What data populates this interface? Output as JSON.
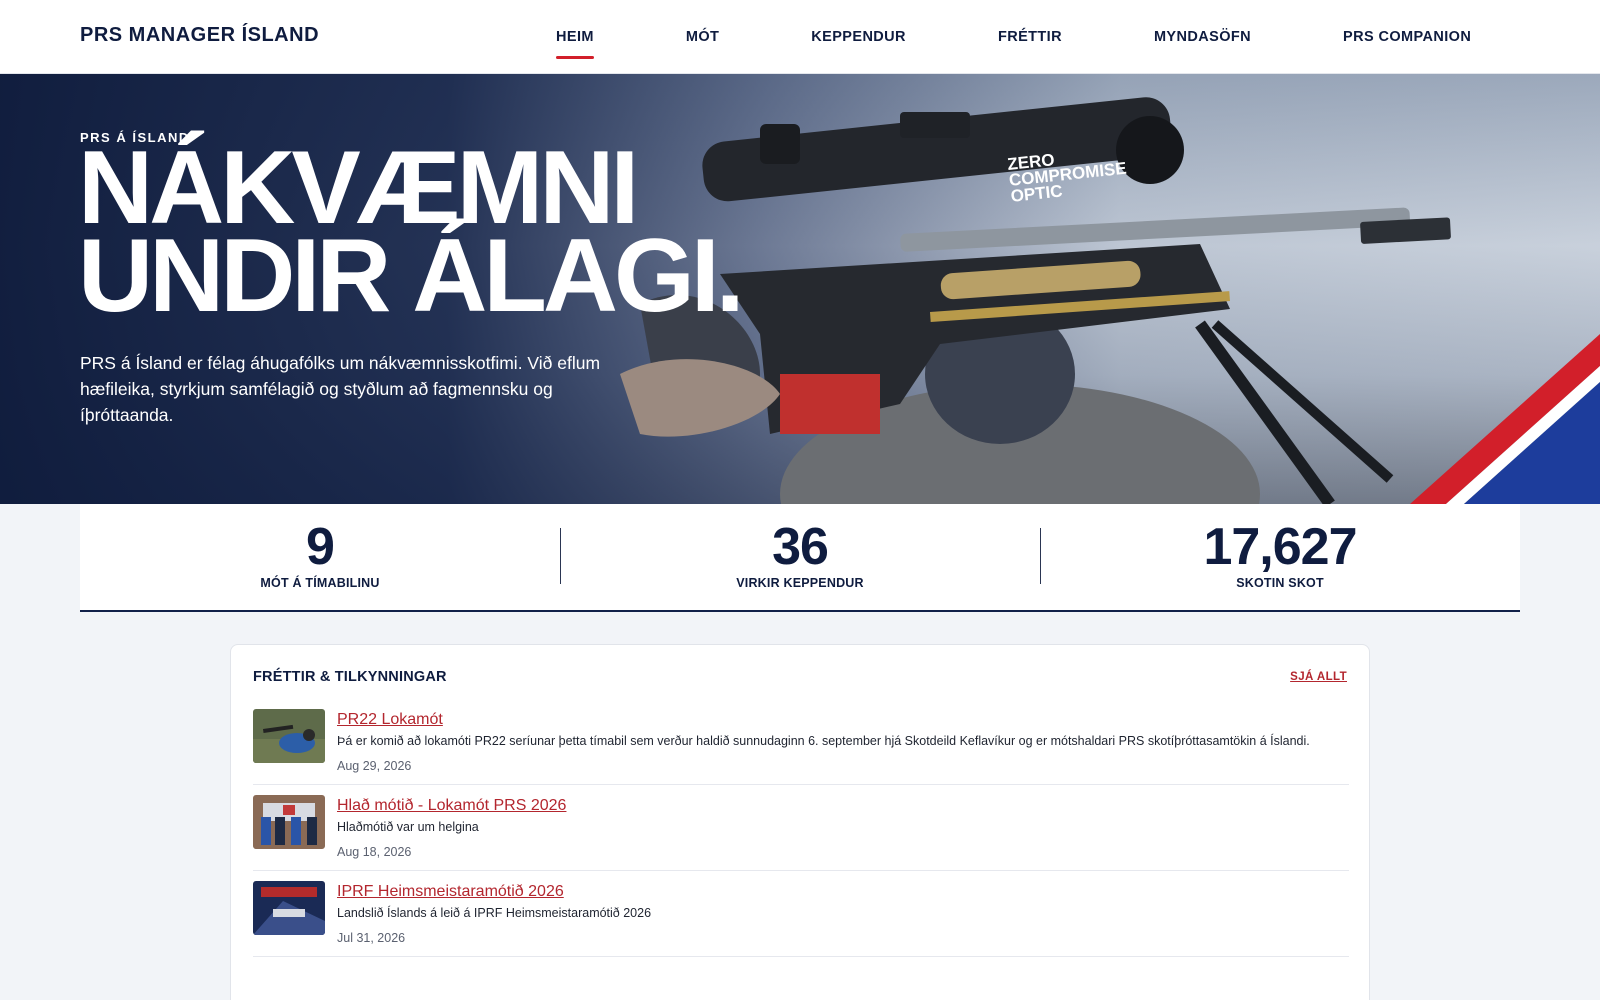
{
  "header": {
    "brand": "PRS MANAGER ÍSLAND",
    "nav": [
      {
        "label": "HEIM",
        "active": true
      },
      {
        "label": "MÓT"
      },
      {
        "label": "KEPPENDUR"
      },
      {
        "label": "FRÉTTIR"
      },
      {
        "label": "MYNDASÖFN"
      },
      {
        "label": "PRS COMPANION"
      }
    ]
  },
  "hero": {
    "kicker": "PRS Á ÍSLAND",
    "title_line1": "NÁKVÆMNI",
    "title_line2": "UNDIR ÁLAGI.",
    "text": "PRS á Ísland er félag áhugafólks um nákvæmnisskotfimi. Við eflum hæfileika, styrkjum samfélagið og styðlum að fagmennsku og íþróttaanda.",
    "image_text": [
      "ZERO",
      "COMPROMISE",
      "OPTIC"
    ],
    "colors": {
      "flag_red": "#d21f2a",
      "flag_blue": "#1d3d9c",
      "navy": "#0f1c3f"
    }
  },
  "stats": [
    {
      "value": "9",
      "label": "MÓT Á TÍMABILINU"
    },
    {
      "value": "36",
      "label": "VIRKIR KEPPENDUR"
    },
    {
      "value": "17,627",
      "label": "SKOTIN SKOT"
    }
  ],
  "news": {
    "heading": "FRÉTTIR & TILKYNNINGAR",
    "see_all": "SJÁ ALLT",
    "items": [
      {
        "title": "PR22 Lokamót",
        "text": "Þá er komið að lokamóti PR22 seríunar þetta tímabil sem verður haldið sunnudaginn 6. september hjá Skotdeild Keflavíkur og er mótshaldari PRS skotíþróttasamtökin á Íslandi.",
        "date": "Aug 29, 2026"
      },
      {
        "title": "Hlað mótið - Lokamót PRS 2026",
        "text": "Hlaðmótið var um helgina",
        "date": "Aug 18, 2026"
      },
      {
        "title": "IPRF Heimsmeistaramótið 2026",
        "text": "Landslið Íslands á leið á IPRF Heimsmeistaramótið 2026",
        "date": "Jul 31, 2026"
      }
    ]
  }
}
